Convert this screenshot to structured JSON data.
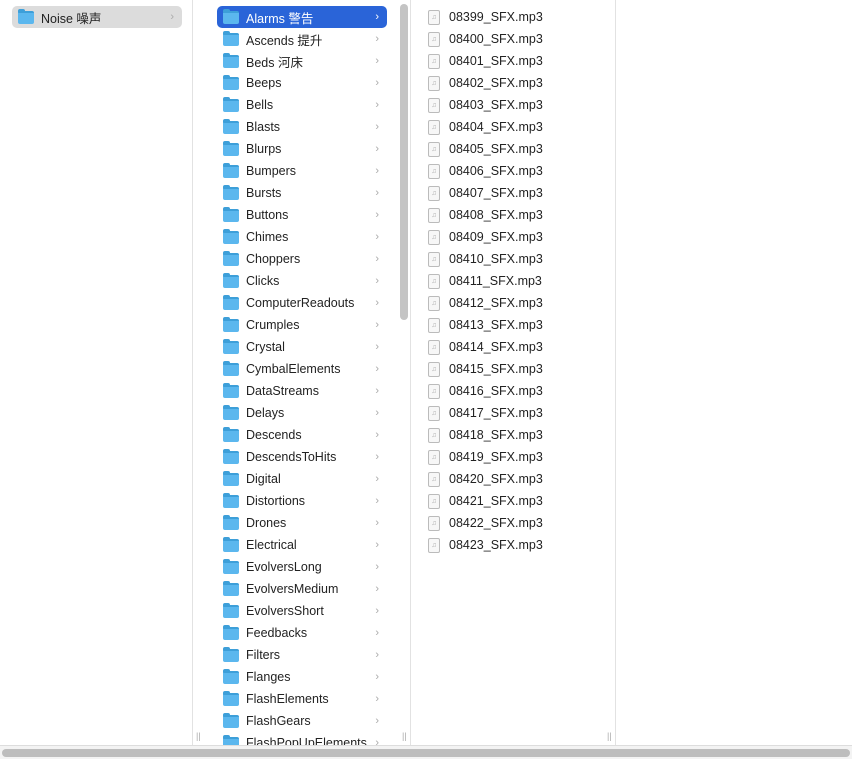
{
  "column1": {
    "items": [
      {
        "label": "Noise 噪声",
        "selected": true
      }
    ]
  },
  "column2": {
    "items": [
      "Alarms 警告",
      "Ascends 提升",
      "Beds 河床",
      "Beeps",
      "Bells",
      "Blasts",
      "Blurps",
      "Bumpers",
      "Bursts",
      "Buttons",
      "Chimes",
      "Choppers",
      "Clicks",
      "ComputerReadouts",
      "Crumples",
      "Crystal",
      "CymbalElements",
      "DataStreams",
      "Delays",
      "Descends",
      "DescendsToHits",
      "Digital",
      "Distortions",
      "Drones",
      "Electrical",
      "EvolversLong",
      "EvolversMedium",
      "EvolversShort",
      "Feedbacks",
      "Filters",
      "Flanges",
      "FlashElements",
      "FlashGears",
      "FlashPopUpElements"
    ],
    "selected_index": 0
  },
  "column3": {
    "items": [
      "08399_SFX.mp3",
      "08400_SFX.mp3",
      "08401_SFX.mp3",
      "08402_SFX.mp3",
      "08403_SFX.mp3",
      "08404_SFX.mp3",
      "08405_SFX.mp3",
      "08406_SFX.mp3",
      "08407_SFX.mp3",
      "08408_SFX.mp3",
      "08409_SFX.mp3",
      "08410_SFX.mp3",
      "08411_SFX.mp3",
      "08412_SFX.mp3",
      "08413_SFX.mp3",
      "08414_SFX.mp3",
      "08415_SFX.mp3",
      "08416_SFX.mp3",
      "08417_SFX.mp3",
      "08418_SFX.mp3",
      "08419_SFX.mp3",
      "08420_SFX.mp3",
      "08421_SFX.mp3",
      "08422_SFX.mp3",
      "08423_SFX.mp3"
    ]
  },
  "colors": {
    "selection": "#2a64d8",
    "folder": "#5bb7ee"
  }
}
